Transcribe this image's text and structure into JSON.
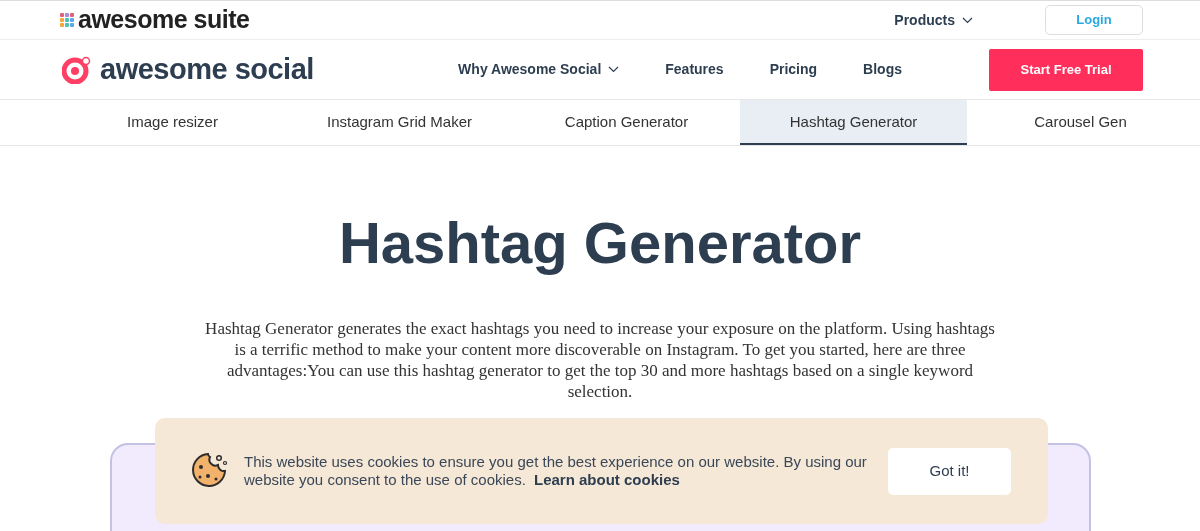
{
  "suite_bar": {
    "logo": "awesome suite",
    "products": "Products",
    "login": "Login"
  },
  "navbar": {
    "logo": "awesome social",
    "items": [
      {
        "label": "Why Awesome Social",
        "dropdown": true
      },
      {
        "label": "Features",
        "dropdown": false
      },
      {
        "label": "Pricing",
        "dropdown": false
      },
      {
        "label": "Blogs",
        "dropdown": false
      }
    ],
    "cta": "Start Free Trial"
  },
  "tools_tabs": [
    {
      "label": "Image resizer",
      "selected": false
    },
    {
      "label": "Instagram Grid Maker",
      "selected": false
    },
    {
      "label": "Caption Generator",
      "selected": false
    },
    {
      "label": "Hashtag Generator",
      "selected": true
    },
    {
      "label": "Carousel Gen",
      "selected": false
    }
  ],
  "hero": {
    "title": "Hashtag Generator",
    "description": "Hashtag Generator generates the exact hashtags you need to increase your exposure on the platform. Using hashtags is a terrific method to make your content more discoverable on Instagram. To get you started, here are three advantages:You can use this hashtag generator to get the top 30 and more hashtags based on a single keyword selection."
  },
  "cookie_banner": {
    "message": "This website uses cookies to ensure you get the best experience on our website. By using our website you consent to the use of cookies.",
    "link": "Learn about cookies",
    "button": "Got it!"
  }
}
